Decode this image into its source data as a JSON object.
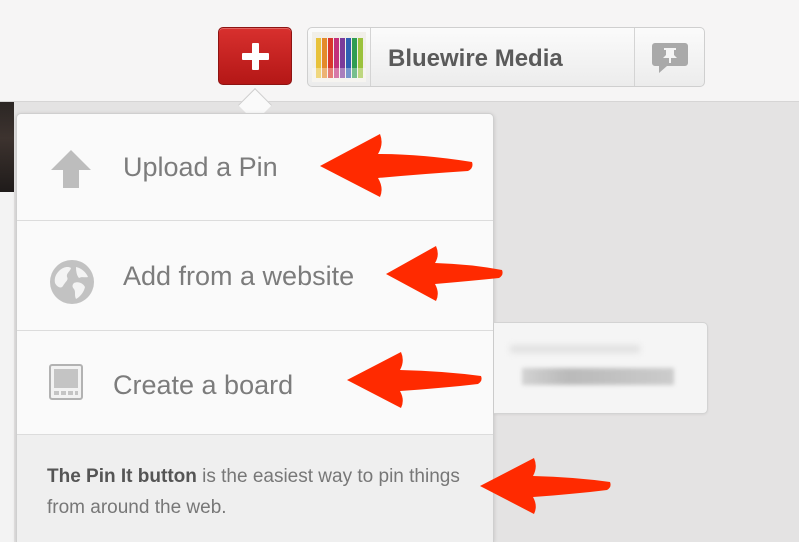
{
  "header": {
    "add_button_icon": "plus-icon",
    "profile_name": "Bluewire Media",
    "avatar_icon": "colored-pencils-icon",
    "notify_icon": "pin-speech-bubble-icon"
  },
  "dropdown": {
    "items": [
      {
        "label": "Upload a Pin",
        "icon": "upload-arrow-icon"
      },
      {
        "label": "Add from a website",
        "icon": "globe-icon"
      },
      {
        "label": "Create a board",
        "icon": "board-icon"
      }
    ],
    "footer_strong": "The Pin It button",
    "footer_rest": " is the easiest way to pin things from around the web."
  },
  "annotations": {
    "arrow_color": "#ff2a00",
    "arrow_icon": "red-arrow-icon"
  },
  "colors": {
    "brand_red": "#cb2027",
    "menu_text": "#7c7c7c"
  }
}
